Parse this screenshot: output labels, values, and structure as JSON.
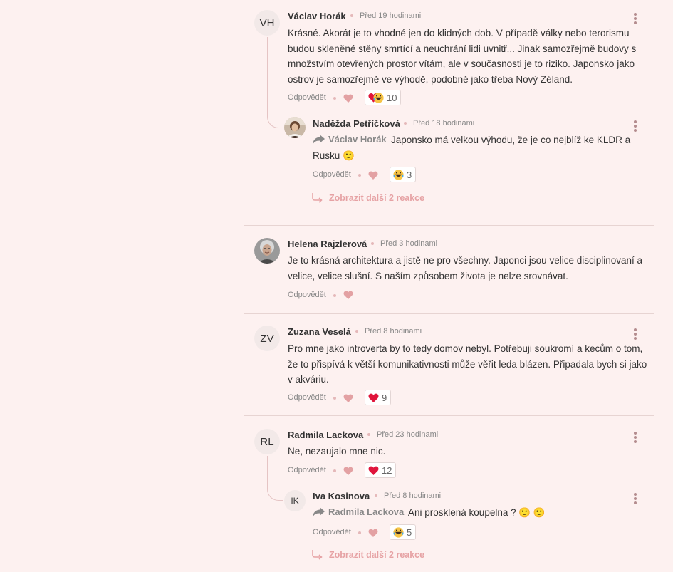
{
  "comments": [
    {
      "initials": "VH",
      "name": "Václav Horák",
      "time": "Před 19 hodinami",
      "text": "Krásné. Akorát je to vhodné jen do klidných dob. V případě války nebo terorismu budou skleněné stěny smrtící a neuchrání lidi uvnitř... Jinak samozřejmě budovy s množstvím otevřených prostor vítám, ale v současnosti je to riziko. Japonsko jako ostrov je samozřejmě ve výhodě, podobně jako třeba Nový Zéland.",
      "reply_label": "Odpovědět",
      "reaction_count": "10",
      "reaction_icon": "heart-laugh-reaction-icon",
      "reply": {
        "name": "Naděžda Petříčková",
        "time": "Před 18 hodinami",
        "mention": "Václav Horák",
        "text": "Japonsko má velkou výhodu, že je co nejblíž ke KLDR a Rusku 🙂",
        "reply_label": "Odpovědět",
        "reaction_count": "3",
        "reaction_icon": "laugh-reaction-icon"
      },
      "more_label": "Zobrazit další 2 reakce"
    },
    {
      "name": "Helena Rajzlerová",
      "time": "Před 3 hodinami",
      "text": "Je to krásná architektura a jistě ne pro všechny. Japonci jsou velice disciplinovaní a velice, velice slušní. S naším způsobem života je nelze srovnávat.",
      "reply_label": "Odpovědět"
    },
    {
      "initials": "ZV",
      "name": "Zuzana Veselá",
      "time": "Před 8 hodinami",
      "text": "Pro mne jako introverta by to tedy domov nebyl. Potřebuji soukromí a kecům o tom, že to přispívá k větší komunikativnosti může věřit leda blázen. Připadala bych si jako v akváriu.",
      "reply_label": "Odpovědět",
      "reaction_count": "9",
      "reaction_icon": "heart-reaction-icon"
    },
    {
      "initials": "RL",
      "name": "Radmila Lackova",
      "time": "Před 23 hodinami",
      "text": "Ne, nezaujalo mne nic.",
      "reply_label": "Odpovědět",
      "reaction_count": "12",
      "reaction_icon": "heart-reaction-icon",
      "reply": {
        "initials": "IK",
        "name": "Iva Kosinova",
        "time": "Před 8 hodinami",
        "mention": "Radmila Lackova",
        "text": "Ani prosklená koupelna ? 🙂 🙂",
        "reply_label": "Odpovědět",
        "reaction_count": "5",
        "reaction_icon": "laugh-reaction-icon"
      },
      "more_label": "Zobrazit další 2 reakce"
    }
  ],
  "colors": {
    "background": "#fdf1f0",
    "accent": "#e6a2a4",
    "heart": "#e0153c"
  }
}
